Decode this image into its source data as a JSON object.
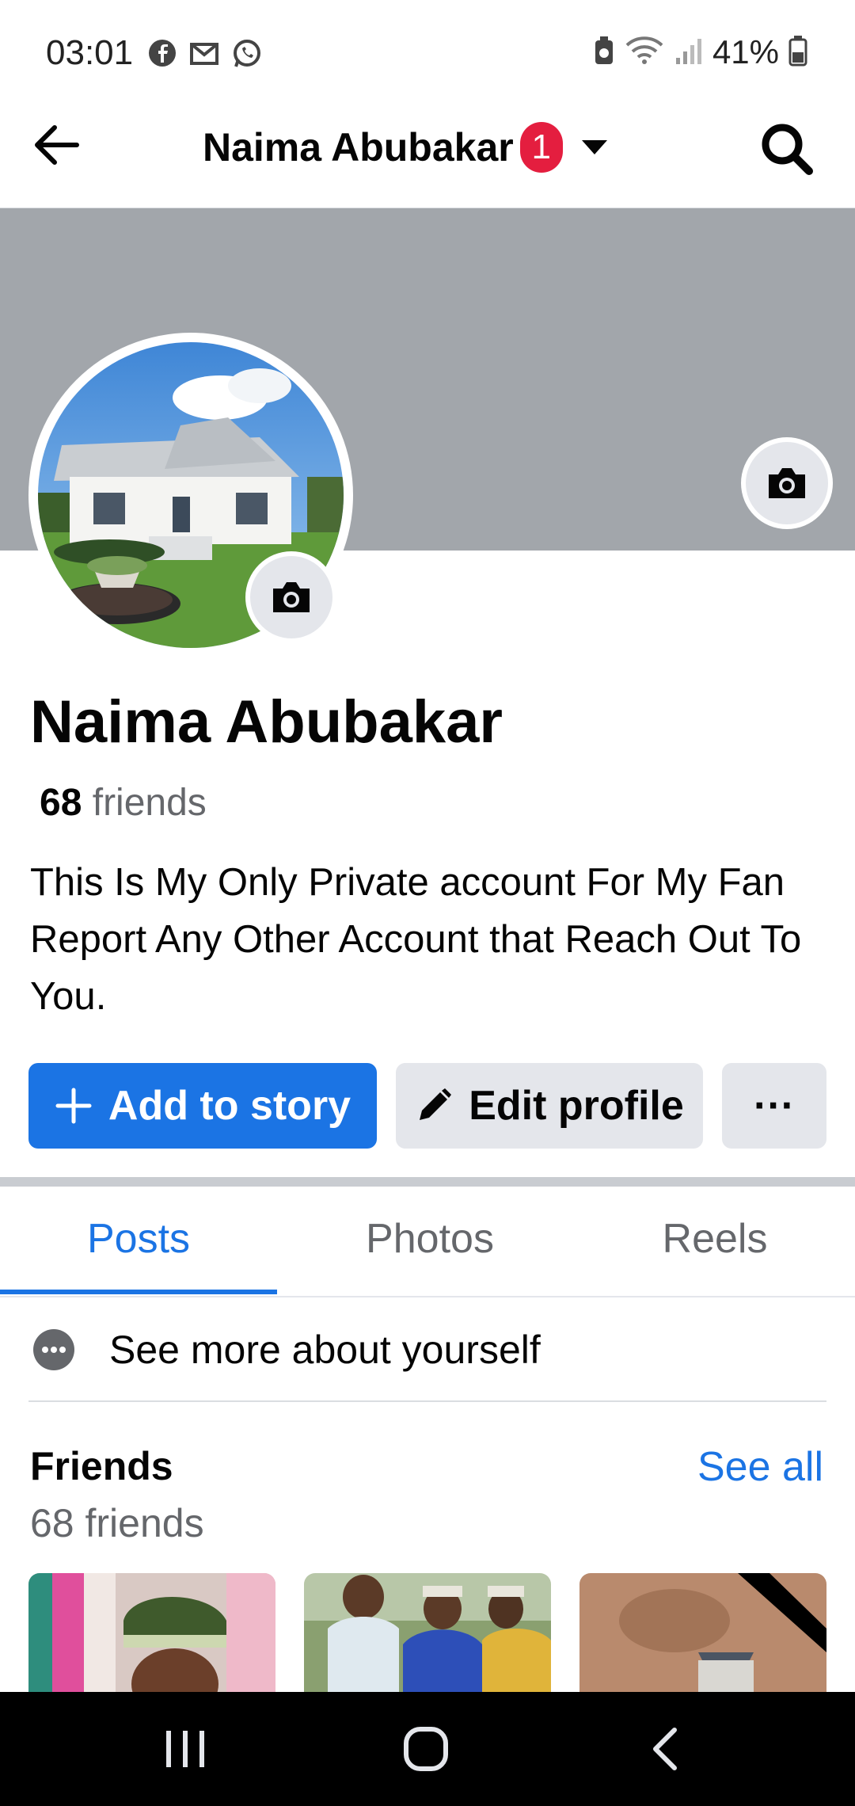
{
  "status_bar": {
    "time": "03:01",
    "battery": "41%",
    "left_icons": [
      "facebook-icon",
      "gmail-icon",
      "whatsapp-icon"
    ],
    "right_icons": [
      "data-saver-icon",
      "wifi-icon",
      "signal-icon",
      "battery-icon"
    ]
  },
  "header": {
    "title": "Naima Abubakar",
    "notification_count": "1",
    "back_icon": "arrow-left-icon",
    "search_icon": "search-icon"
  },
  "profile": {
    "name": "Naima Abubakar",
    "friends_count": "68",
    "friends_word": "friends",
    "bio": "This Is My Only Private account For My Fan Report Any Other Account that Reach Out To You."
  },
  "actions": {
    "add_story": "Add to story",
    "edit_profile": "Edit profile",
    "more": "···"
  },
  "tabs": [
    {
      "label": "Posts",
      "active": true
    },
    {
      "label": "Photos",
      "active": false
    },
    {
      "label": "Reels",
      "active": false
    }
  ],
  "see_more": "See more about yourself",
  "friends_section": {
    "title": "Friends",
    "count_label": "68 friends",
    "see_all": "See all"
  },
  "colors": {
    "accent": "#1b74e4",
    "badge": "#e41e3f",
    "cover": "#a2a6ab",
    "button_gray": "#e4e6eb"
  }
}
